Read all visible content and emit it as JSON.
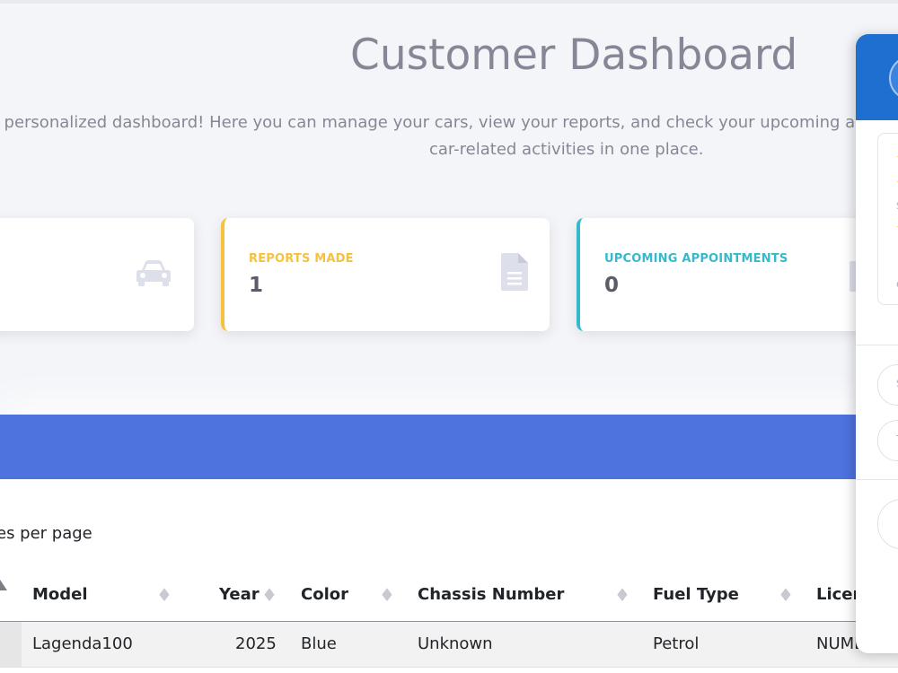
{
  "header": {
    "title": "Customer Dashboard",
    "subtitle_line1": "ur personalized dashboard! Here you can manage your cars, view your reports, and check your upcoming ap",
    "subtitle_line2": "car-related activities in one place."
  },
  "cards": [
    {
      "label": "",
      "value": "",
      "icon": "car-icon",
      "accent": "#4e73df"
    },
    {
      "label": "REPORTS MADE",
      "value": "1",
      "icon": "file-icon",
      "accent": "#f6c23e"
    },
    {
      "label": "UPCOMING APPOINTMENTS",
      "value": "0",
      "icon": "calendar-icon",
      "accent": "#36b9cc"
    }
  ],
  "banner": {
    "color": "#4e73df"
  },
  "table": {
    "per_page_text": "es per page",
    "columns": [
      "Model",
      "Year",
      "Color",
      "Chassis Number",
      "Fuel Type",
      "Licen"
    ],
    "rows": [
      [
        "Lagenda100",
        "2025",
        "Blue",
        "Unknown",
        "Petrol",
        "NUMB"
      ]
    ]
  },
  "widget": {
    "header_color": "#1f6fd1",
    "snippets": [
      "S",
      "T",
      "t",
      "O",
      "S",
      "S"
    ]
  },
  "colors": {
    "text_muted": "#858796",
    "reports_accent": "#f6c23e",
    "appointments_accent": "#36b9cc"
  }
}
